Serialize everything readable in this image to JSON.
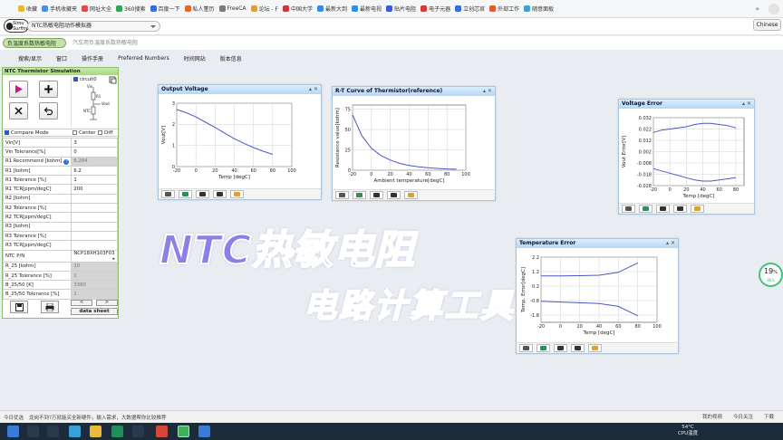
{
  "browser": {
    "bookmarks": [
      "收藏",
      "手机收藏夹",
      "网址大全",
      "360搜索",
      "百度一下",
      "私人董历",
      "FreeCA",
      "论坛 - F",
      "中国大学",
      "最新大到",
      "最新电视",
      "贴片电阻",
      "电子元器",
      "立创芯官",
      "外部工作",
      "随意面板"
    ],
    "more": "»"
  },
  "app": {
    "title_select": "NTC热敏电阻动作模拟器",
    "language_button": "Chinese",
    "tabs": [
      "负温度系数热敏电阻",
      "汽车用负温度系数热敏电阻"
    ],
    "menu": [
      "搜索/显示",
      "窗口",
      "操作手册",
      "Preferred Numbers",
      "时间网站",
      "版本信息"
    ]
  },
  "left_panel": {
    "title": "NTC Thermistor Simulation",
    "circuit_label": "circuit0",
    "circuit_nodes": {
      "vin": "Vin",
      "r1": "R1",
      "vout": "Vout",
      "ntc": "NTC"
    },
    "compare_mode": "Compare Mode",
    "center": "Center",
    "diff": "Diff",
    "rows": [
      {
        "k": "Vin[V]",
        "v": "3",
        "gray": false
      },
      {
        "k": "Vin Tolerance[%]",
        "v": "0",
        "gray": false
      },
      {
        "k": "R1 Recommend [kohm]",
        "v": "6.284",
        "gray": true,
        "help": true
      },
      {
        "k": "R1 [kohm]",
        "v": "6.2",
        "gray": false
      },
      {
        "k": "R1 Tolerance [%]",
        "v": "1",
        "gray": false
      },
      {
        "k": "R1 TCR[ppm/degC]",
        "v": "200",
        "gray": false
      },
      {
        "k": "R2 [kohm]",
        "v": "",
        "gray": false
      },
      {
        "k": "R2 Tolerance [%]",
        "v": "",
        "gray": false
      },
      {
        "k": "R2 TCR[ppm/degC]",
        "v": "",
        "gray": false
      },
      {
        "k": "R3 [kohm]",
        "v": "",
        "gray": false
      },
      {
        "k": "R3 Tolerance [%]",
        "v": "",
        "gray": false
      },
      {
        "k": "R3 TCR[ppm/degC]",
        "v": "",
        "gray": false
      },
      {
        "k": "NTC P/N",
        "v": "NCP18XH103F03",
        "gray": false,
        "dropdown": true
      },
      {
        "k": "R_25 [kohm]",
        "v": "10",
        "gray": true
      },
      {
        "k": "R_25 Tolerance [%]",
        "v": "1",
        "gray": true
      },
      {
        "k": "B_25/50 [K]",
        "v": "3380",
        "gray": true
      },
      {
        "k": "B_25/50 Tolerance [%]",
        "v": "1",
        "gray": true
      }
    ],
    "prev": "<",
    "next": ">",
    "datasheet": "data sheet"
  },
  "charts": {
    "output_voltage": {
      "title": "Output Voltage",
      "xlabel": "Temp [degC]",
      "ylabel": "Vout[V]",
      "xticks": [
        "-20",
        "0",
        "20",
        "40",
        "60",
        "80",
        "100"
      ],
      "yticks": [
        "3",
        "2",
        "1",
        "0"
      ]
    },
    "rt_curve": {
      "title": "R-T Curve of Thermistor(reference)",
      "xlabel": "Ambient temperature[degC]",
      "ylabel": "Resistance value[kohm]",
      "xticks": [
        "-20",
        "0",
        "20",
        "40",
        "60",
        "80",
        "100"
      ],
      "yticks": [
        "75",
        "50",
        "25",
        "0"
      ]
    },
    "voltage_error": {
      "title": "Voltage Error",
      "xlabel": "Temp [degC]",
      "ylabel": "Vout Error[V]",
      "xticks": [
        "-20",
        "0",
        "20",
        "40",
        "60",
        "80"
      ],
      "yticks": [
        "0.032",
        "0.022",
        "0.012",
        "0.002",
        "-0.008",
        "-0.018",
        "-0.028"
      ]
    },
    "temperature_error": {
      "title": "Temperature Error",
      "xlabel": "Temp [degC]",
      "ylabel": "Temp. Error[degC]",
      "xticks": [
        "-20",
        "0",
        "20",
        "40",
        "60",
        "80",
        "100"
      ],
      "yticks": [
        "2.2",
        "1.2",
        "0.2",
        "-0.8",
        "-1.8"
      ]
    }
  },
  "chart_data": [
    {
      "type": "line",
      "title": "Output Voltage",
      "xlabel": "Temp [degC]",
      "ylabel": "Vout[V]",
      "xlim": [
        -20,
        100
      ],
      "ylim": [
        0,
        3
      ],
      "series": [
        {
          "x": [
            -20,
            -10,
            0,
            10,
            20,
            30,
            40,
            50,
            60,
            70,
            80
          ],
          "y": [
            2.7,
            2.55,
            2.35,
            2.1,
            1.85,
            1.58,
            1.32,
            1.1,
            0.9,
            0.73,
            0.58
          ]
        }
      ]
    },
    {
      "type": "line",
      "title": "R-T Curve of Thermistor(reference)",
      "xlabel": "Ambient temperature[degC]",
      "ylabel": "Resistance value[kohm]",
      "xlim": [
        -20,
        100
      ],
      "ylim": [
        0,
        80
      ],
      "series": [
        {
          "x": [
            -20,
            -10,
            0,
            10,
            20,
            30,
            40,
            50,
            60,
            70,
            80,
            90
          ],
          "y": [
            68,
            42,
            27,
            18,
            12.5,
            8.3,
            5.8,
            4.2,
            3,
            2.2,
            1.6,
            1.2
          ]
        }
      ]
    },
    {
      "type": "line",
      "title": "Voltage Error",
      "xlabel": "Temp [degC]",
      "ylabel": "Vout Error[V]",
      "xlim": [
        -20,
        90
      ],
      "ylim": [
        -0.028,
        0.032
      ],
      "series": [
        {
          "x": [
            -20,
            -10,
            0,
            10,
            20,
            30,
            40,
            50,
            60,
            70,
            80
          ],
          "y": [
            0.019,
            0.021,
            0.022,
            0.023,
            0.024,
            0.026,
            0.027,
            0.027,
            0.026,
            0.025,
            0.023
          ]
        },
        {
          "x": [
            -20,
            -10,
            0,
            10,
            20,
            30,
            40,
            50,
            60,
            70,
            80
          ],
          "y": [
            -0.013,
            -0.015,
            -0.017,
            -0.019,
            -0.021,
            -0.023,
            -0.024,
            -0.024,
            -0.023,
            -0.022,
            -0.021
          ]
        }
      ]
    },
    {
      "type": "line",
      "title": "Temperature Error",
      "xlabel": "Temp [degC]",
      "ylabel": "Temp. Error[degC]",
      "xlim": [
        -20,
        100
      ],
      "ylim": [
        -2.3,
        2.2
      ],
      "series": [
        {
          "x": [
            -20,
            0,
            20,
            40,
            60,
            80
          ],
          "y": [
            0.9,
            0.9,
            0.92,
            0.95,
            1.15,
            1.8
          ]
        },
        {
          "x": [
            -20,
            0,
            20,
            40,
            60,
            80
          ],
          "y": [
            -0.85,
            -0.9,
            -0.95,
            -1.0,
            -1.2,
            -1.85
          ]
        }
      ]
    }
  ],
  "overlay": {
    "line1": "NTC热敏电阻",
    "line2": "电路计算工具"
  },
  "cpu_gauge": {
    "percent": "19",
    "unit": "%",
    "speed": "8K/s"
  },
  "status_bar": {
    "left": [
      "今日优选",
      "龙岗不到?万就能买全新硬件，输入需求，大数据帮你比较推荐"
    ],
    "right": [
      "我的视频",
      "今日关注",
      "下载"
    ]
  },
  "taskbar": {
    "temp": "54°C",
    "cpu_label": "CPU温度"
  },
  "colors": {
    "tab_green": "#c7e0b2",
    "window_title": "#b4d7f3",
    "curve": "#4a57c8",
    "overlay": "#8e7fe6"
  }
}
